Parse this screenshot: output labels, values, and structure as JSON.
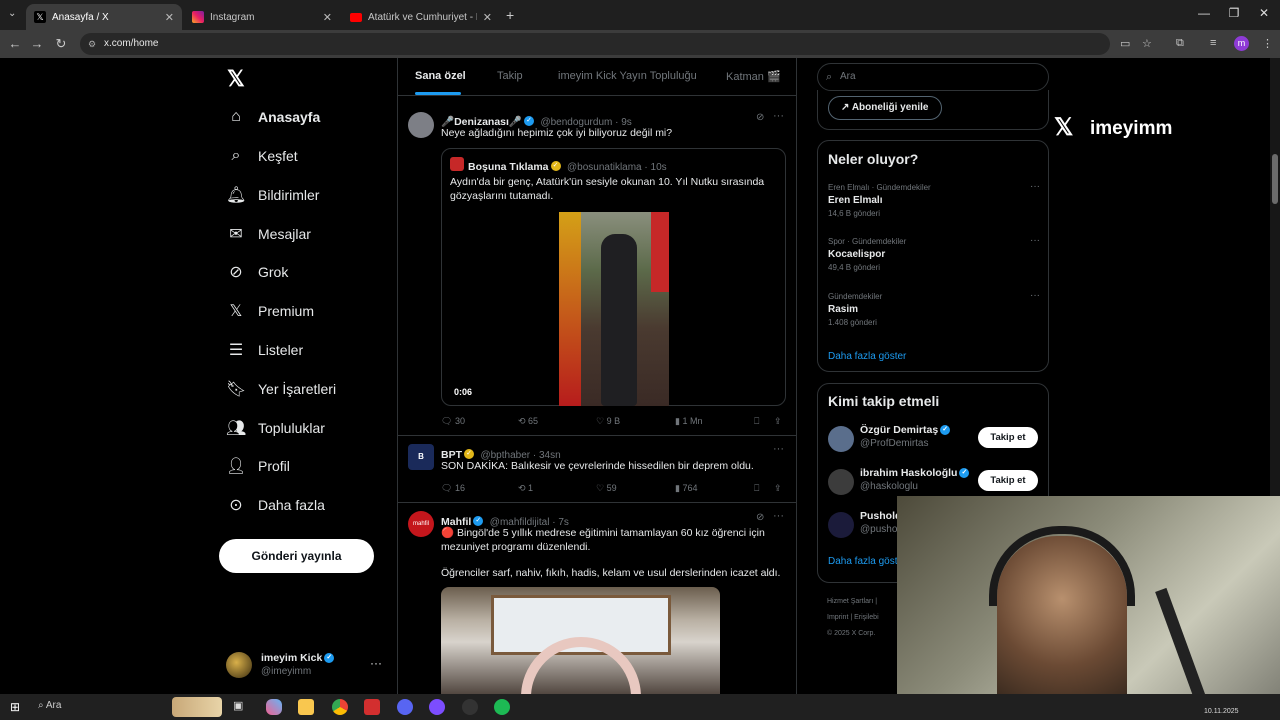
{
  "browser": {
    "tabs": [
      {
        "title": "Anasayfa / X",
        "active": true
      },
      {
        "title": "Instagram",
        "active": false
      },
      {
        "title": "Atatürk ve Cumhuriyet - Belgesel",
        "active": false
      }
    ],
    "url": "x.com/home",
    "profile_initial": "m"
  },
  "sidebar": {
    "items": [
      {
        "label": "Anasayfa",
        "icon": "home-icon"
      },
      {
        "label": "Keşfet",
        "icon": "search-icon"
      },
      {
        "label": "Bildirimler",
        "icon": "bell-icon"
      },
      {
        "label": "Mesajlar",
        "icon": "mail-icon"
      },
      {
        "label": "Grok",
        "icon": "grok-icon"
      },
      {
        "label": "Premium",
        "icon": "x-logo-icon"
      },
      {
        "label": "Listeler",
        "icon": "list-icon"
      },
      {
        "label": "Yer İşaretleri",
        "icon": "bookmark-icon"
      },
      {
        "label": "Topluluklar",
        "icon": "communities-icon"
      },
      {
        "label": "Profil",
        "icon": "profile-icon"
      },
      {
        "label": "Daha fazla",
        "icon": "more-circle-icon"
      }
    ],
    "post_button": "Gönderi yayınla",
    "account": {
      "name": "imeyim Kick",
      "handle": "@imeyimm"
    }
  },
  "feed": {
    "tabs": [
      "Sana özel",
      "Takip",
      "imeyim Kick Yayın Topluluğu",
      "Katman 🎬"
    ],
    "tweets": [
      {
        "name": "🎤Denizanası🎤",
        "handle": "@bendogurdum",
        "time": "9s",
        "text": "Neye ağladığını hepimiz çok iyi biliyoruz değil mi?",
        "quote": {
          "name": "Boşuna Tıklama",
          "handle": "@bosunatiklama",
          "time": "10s",
          "text": "Aydın'da bir genç, Atatürk'ün sesiyle okunan 10. Yıl Nutku sırasında gözyaşlarını tutamadı.",
          "duration": "0:06"
        },
        "replies": "30",
        "reposts": "65",
        "likes": "9 B",
        "views": "1 Mn"
      },
      {
        "name": "BPT",
        "handle": "@bpthaber",
        "time": "34sn",
        "text": "SON DAKİKA: Balıkesir ve çevrelerinde hissedilen bir deprem oldu.",
        "replies": "16",
        "reposts": "1",
        "likes": "59",
        "views": "764"
      },
      {
        "name": "Mahfil",
        "handle": "@mahfildijital",
        "time": "7s",
        "text": "🔴 Bingöl'de 5 yıllık medrese eğitimini tamamlayan 60 kız öğrenci için mezuniyet programı düzenlendi.",
        "text2": "Öğrenciler sarf, nahiv, fıkıh, hadis, kelam ve usul derslerinden icazet aldı."
      }
    ]
  },
  "right": {
    "search_placeholder": "Ara",
    "subscribe": "Aboneliği yenile",
    "trends_title": "Neler oluyor?",
    "trends": [
      {
        "category": "Eren Elmalı · Gündemdekiler",
        "name": "Eren Elmalı",
        "count": "14,6 B gönderi"
      },
      {
        "category": "Spor · Gündemdekiler",
        "name": "Kocaelispor",
        "count": "49,4 B gönderi"
      },
      {
        "category": "Gündemdekiler",
        "name": "Rasim",
        "count": "1.408 gönderi"
      }
    ],
    "show_more": "Daha fazla göster",
    "wtf_title": "Kimi takip etmeli",
    "who_to_follow": [
      {
        "name": "Özgür Demirtaş",
        "handle": "@ProfDemirtas",
        "button": "Takip et"
      },
      {
        "name": "ibrahim Haskoloğlu",
        "handle": "@haskologlu",
        "button": "Takip et"
      },
      {
        "name": "Pushold",
        "handle": "@pusho"
      }
    ],
    "show_more2": "Daha fazla göst",
    "footer": [
      "Hizmet Şartları",
      "Imprint",
      "Erişilebi",
      "© 2025 X Corp."
    ]
  },
  "overlay": {
    "brand": "imeyimm"
  },
  "taskbar": {
    "search": "Ara",
    "date": "10.11.2025"
  },
  "colors": {
    "accent": "#1d9bf0",
    "bg": "#000000",
    "border": "#2f3336",
    "muted": "#71767b"
  }
}
